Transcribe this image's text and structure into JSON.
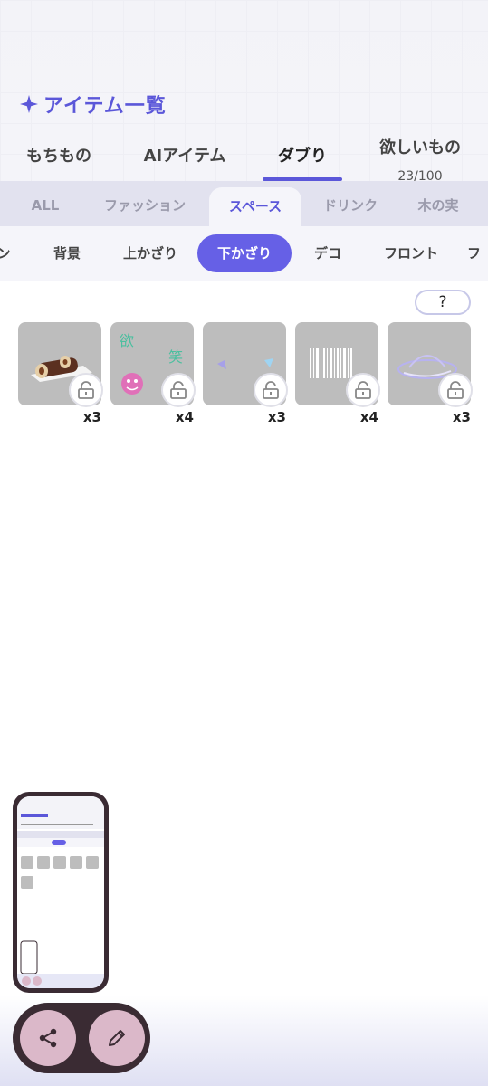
{
  "header": {
    "title": "アイテム一覧"
  },
  "main_tabs": [
    {
      "label": "もちもの"
    },
    {
      "label": "AIアイテム"
    },
    {
      "label": "ダブり",
      "active": true
    },
    {
      "label": "欲しいもの",
      "sub": "23/100"
    }
  ],
  "categories": [
    "ALL",
    "ファッション",
    "スペース",
    "ドリンク",
    "木の実"
  ],
  "active_category": "スペース",
  "subcategories": [
    "ン",
    "背景",
    "上かざり",
    "下かざり",
    "デコ",
    "フロント",
    "フ"
  ],
  "active_subcategory": "下かざり",
  "help_label": "?",
  "items": [
    {
      "count": "x3",
      "thumb": "roll-cake"
    },
    {
      "count": "x4",
      "thumb": "green-text-stickers"
    },
    {
      "count": "x3",
      "thumb": "ribbons"
    },
    {
      "count": "x4",
      "thumb": "barcode"
    },
    {
      "count": "x3",
      "thumb": "holographic-hat"
    }
  ],
  "colors": {
    "accent": "#5b57d9",
    "active_chip": "#6660e6",
    "item_bg": "#bdbdbd",
    "fab_bg": "#3a2b33",
    "fab_button": "#dbb8c9"
  }
}
